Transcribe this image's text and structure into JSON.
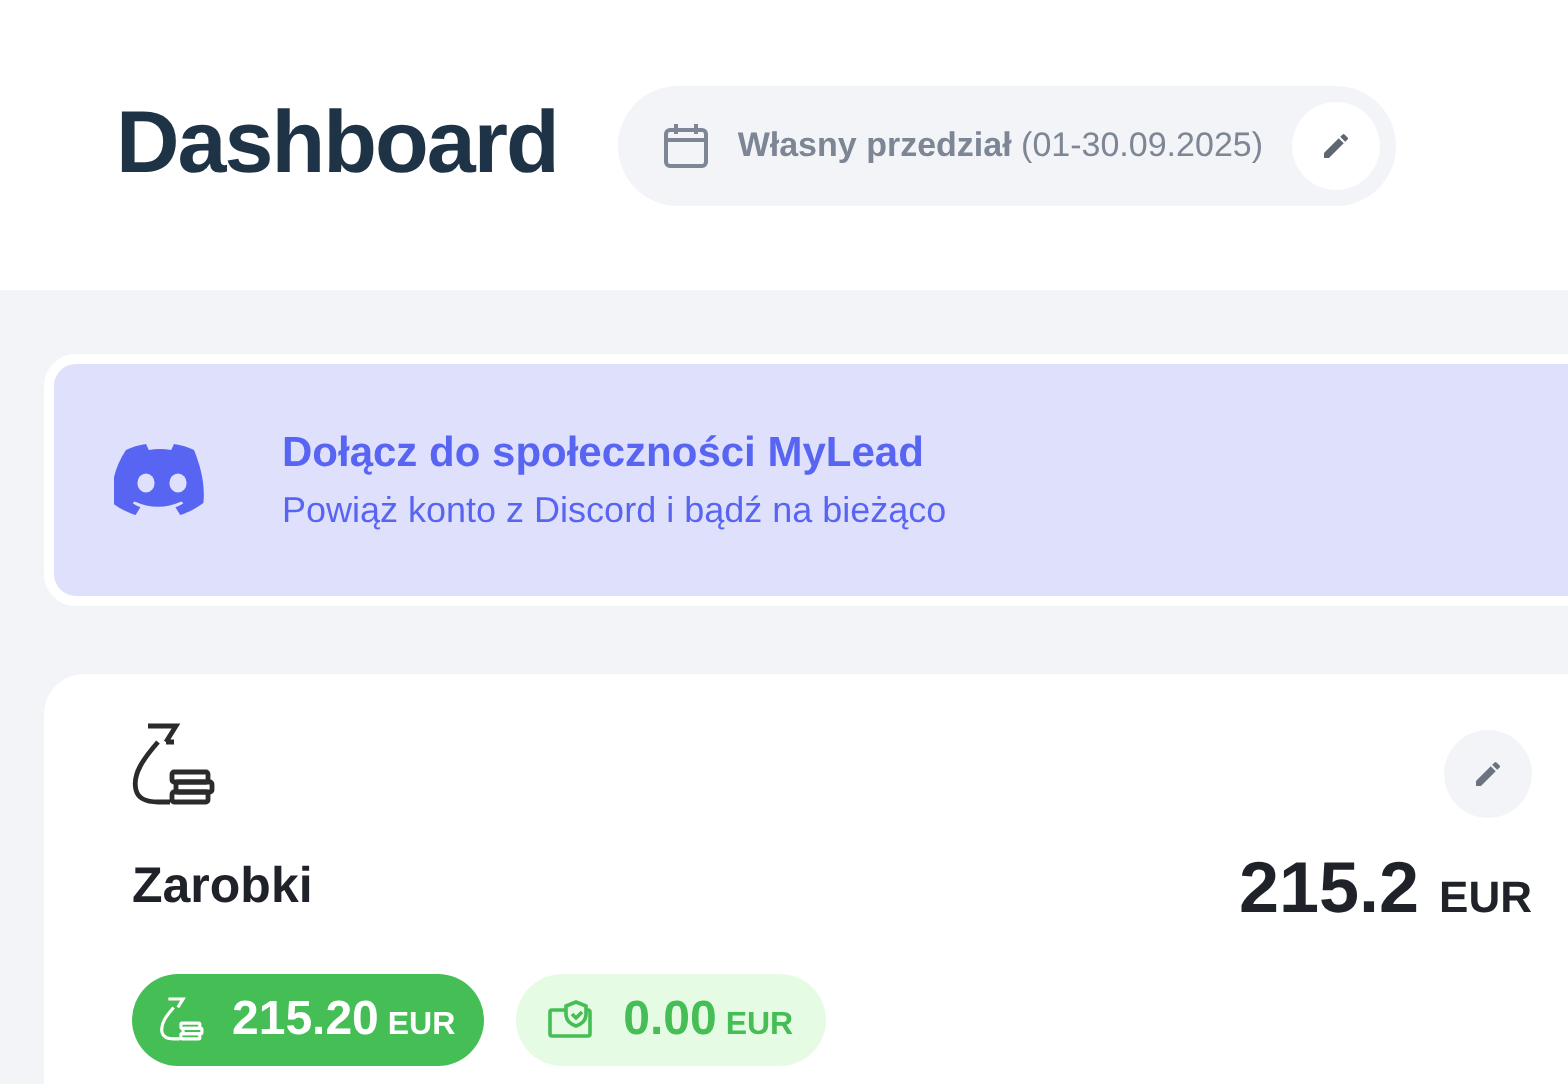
{
  "header": {
    "title": "Dashboard",
    "date_range": "**Własny przedział** (01-30.09.2025)"
  },
  "banner": {
    "title": "Dołącz do społeczności MyLead",
    "subtitle": "Powiąż konto z Discord i bądź na bieżąco"
  },
  "earnings": {
    "title": "Zarobki",
    "total": "215.2",
    "total_currency": "EUR",
    "pills": [
      {
        "kind": "filled",
        "amount": "215.20",
        "currency": "EUR"
      },
      {
        "kind": "light",
        "amount": "0.00",
        "currency": "EUR"
      }
    ]
  }
}
